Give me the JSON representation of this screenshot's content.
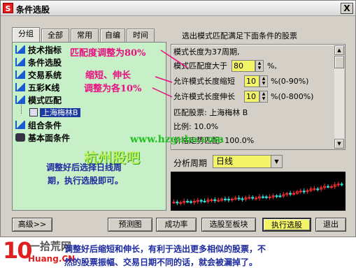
{
  "window": {
    "app_icon": "S",
    "title": "条件选股",
    "close_label": "X"
  },
  "tabs": [
    {
      "label": "分组"
    },
    {
      "label": "全部"
    },
    {
      "label": "常用"
    },
    {
      "label": "自编"
    },
    {
      "label": "时间"
    }
  ],
  "tree": {
    "items": [
      {
        "label": "技术指标",
        "icon": "house-icon"
      },
      {
        "label": "条件选股",
        "icon": "house-icon"
      },
      {
        "label": "交易系统",
        "icon": "house-icon"
      },
      {
        "label": "五彩K线",
        "icon": "house-icon"
      },
      {
        "label": "模式匹配",
        "icon": "house-icon"
      },
      {
        "label": "组合条件",
        "icon": "house-icon"
      },
      {
        "label": "基本面条件",
        "icon": "binoculars-icon"
      }
    ],
    "selected_child": "上海梅林B"
  },
  "right": {
    "header": "选出模式匹配满足下面条件的股票",
    "pattern_length": "模式长度为37周期,",
    "match_label": "模式匹配度大于",
    "match_value": "80",
    "match_unit": "%,",
    "shrink_label": "允许模式长度缩短",
    "shrink_value": "10",
    "shrink_unit": "%(0-90%)",
    "extend_label": "允许模式长度伸长",
    "extend_value": "10",
    "extend_unit": "%(0-800%)",
    "match_stock": "匹配股票: 上海梅林 B",
    "ratio": "比例: 10.0%",
    "price_match": "价格走势匹配: 100.0%",
    "period_label": "分析周期",
    "period_value": "日线"
  },
  "buttons": {
    "advanced": "高级>>",
    "predict": "预测图",
    "success_rate": "成功率",
    "to_sector": "选股至板块",
    "execute": "执行选股",
    "exit": "退出"
  },
  "annotations": {
    "match_note": "匹配度调整为80%",
    "shrink_note_line1": "缩短、伸长",
    "shrink_note_line2": "调整为各10%",
    "watermark_url": "www.hzguba.com",
    "watermark_cn": "杭州股吧",
    "period_note_line1": "调整好后选择日线周",
    "period_note_line2": "期，执行选股即可。",
    "bottom_line1": "调整好后缩短和伸长，有利于选出更多相似的股票，不",
    "bottom_line2": "然的股票振幅、交易日期不同的话，就会被漏掉了。"
  },
  "logo": {
    "main": "10",
    "cn": "一拾荒网",
    "url": "Huang.CN"
  },
  "colors": {
    "tree_bg": "#c8f0c8",
    "highlight": "#f4f468",
    "annotation_pink": "#e81080",
    "annotation_blue": "#1c2aa0",
    "watermark_green": "#22aa22",
    "candle_up": "#ff3030",
    "candle_down": "#30e0e0"
  }
}
